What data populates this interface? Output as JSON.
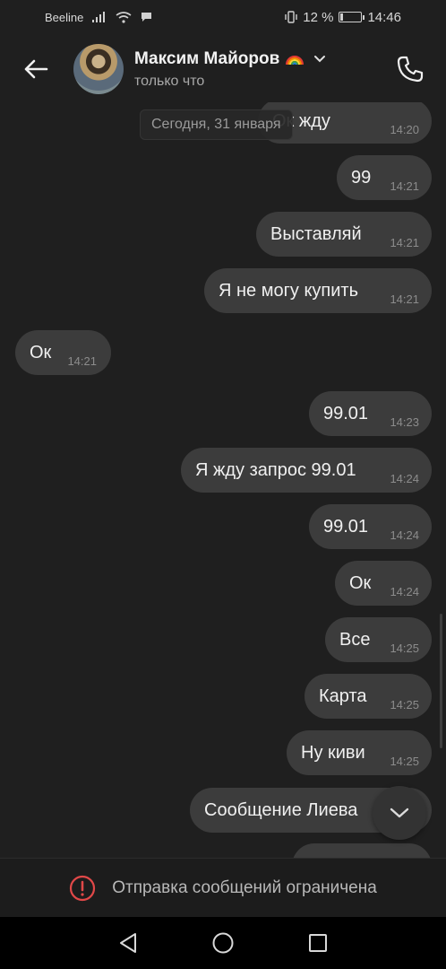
{
  "status_bar": {
    "carrier": "Beeline",
    "battery_percent": "12 %",
    "battery_level": 0.12,
    "time": "14:46"
  },
  "header": {
    "contact_name": "Максим Майоров",
    "last_seen": "только что"
  },
  "chat": {
    "date_label": "Сегодня, 31 января",
    "messages": [
      {
        "direction": "out",
        "text": "Ок жду",
        "time": "14:20"
      },
      {
        "direction": "out",
        "text": "99",
        "time": "14:21"
      },
      {
        "direction": "out",
        "text": "Выставляй",
        "time": "14:21"
      },
      {
        "direction": "out",
        "text": "Я не могу купить",
        "time": "14:21"
      },
      {
        "direction": "in",
        "text": "Ок",
        "time": "14:21"
      },
      {
        "direction": "out",
        "text": "99.01",
        "time": "14:23"
      },
      {
        "direction": "out",
        "text": "Я жду запрос 99.01",
        "time": "14:24"
      },
      {
        "direction": "out",
        "text": "99.01",
        "time": "14:24"
      },
      {
        "direction": "out",
        "text": "Ок",
        "time": "14:24"
      },
      {
        "direction": "out",
        "text": "Все",
        "time": "14:25"
      },
      {
        "direction": "out",
        "text": "Карта",
        "time": "14:25"
      },
      {
        "direction": "out",
        "text": "Ну киви",
        "time": "14:25"
      },
      {
        "direction": "out",
        "text": "Сообщение Лиева",
        "time": ""
      }
    ]
  },
  "bottom_bar": {
    "restricted_text": "Отправка сообщений ограничена",
    "icon": "alert-circle-icon",
    "icon_color": "#e04848"
  },
  "colors": {
    "background": "#1f1f1f",
    "bubble": "#3c3c3c"
  }
}
